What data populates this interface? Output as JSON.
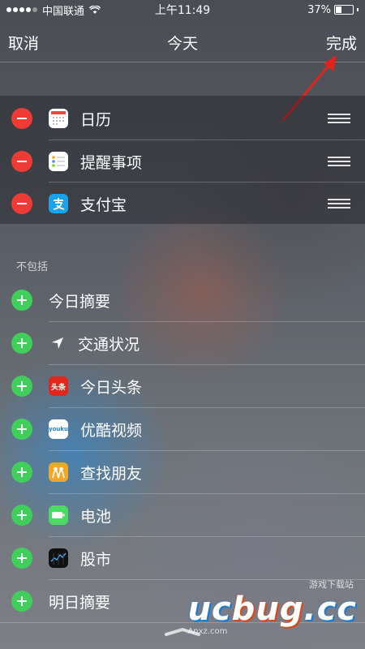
{
  "status_bar": {
    "carrier": "中国联通",
    "time": "上午11:49",
    "battery_percent": "37%",
    "battery_level": 0.37,
    "signal_icon": "signal-dots-icon",
    "wifi_icon": "wifi-icon"
  },
  "nav": {
    "cancel": "取消",
    "title": "今天",
    "done": "完成"
  },
  "included": [
    {
      "label": "日历",
      "icon": "calendar-icon"
    },
    {
      "label": "提醒事项",
      "icon": "reminders-icon"
    },
    {
      "label": "支付宝",
      "icon": "alipay-icon"
    }
  ],
  "excluded_title": "不包括",
  "excluded": [
    {
      "label": "今日摘要",
      "icon": ""
    },
    {
      "label": "交通状况",
      "icon": "location-arrow-icon"
    },
    {
      "label": "今日头条",
      "icon": "toutiao-icon",
      "icon_text": "头条"
    },
    {
      "label": "优酷视频",
      "icon": "youku-icon",
      "icon_text": "youku"
    },
    {
      "label": "查找朋友",
      "icon": "find-friends-icon"
    },
    {
      "label": "电池",
      "icon": "battery-widget-icon"
    },
    {
      "label": "股市",
      "icon": "stocks-icon"
    },
    {
      "label": "明日摘要",
      "icon": ""
    }
  ],
  "watermark": {
    "main_a": "uc",
    "main_b": "bug",
    "main_c": ".cc",
    "top": "游戏下载站",
    "sub": "Anxz.com"
  },
  "colors": {
    "remove": "#ef3b36",
    "add": "#3fcf5a",
    "annotation_arrow": "#e0231c"
  }
}
